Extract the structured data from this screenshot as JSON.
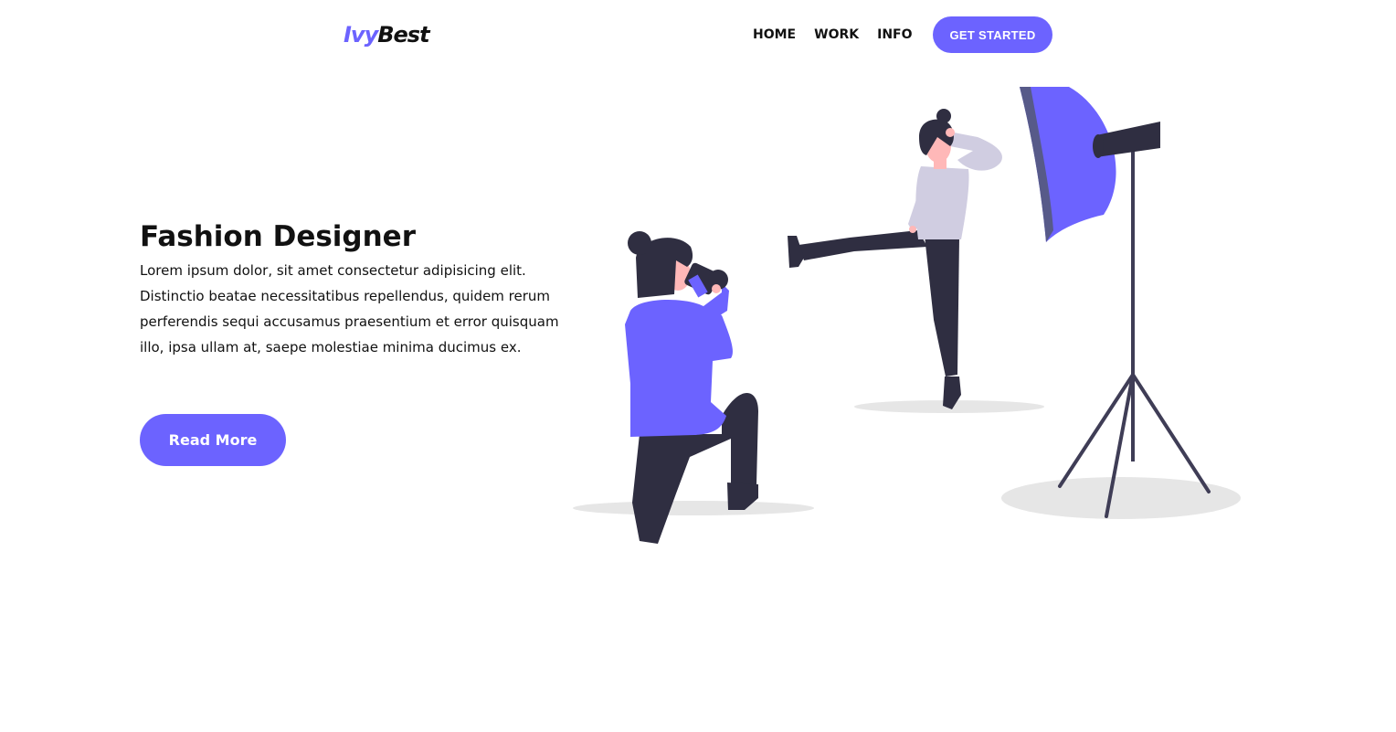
{
  "header": {
    "logo_part1": "Ivy",
    "logo_part2": "Best",
    "nav": [
      "HOME",
      "WORK",
      "INFO"
    ],
    "cta_label": "GET STARTED"
  },
  "hero": {
    "title": "Fashion Designer",
    "text": "Lorem ipsum dolor, sit amet consectetur adipisicing elit. Distinctio beatae necessitatibus repellendus, quidem rerum perferendis sequi accusamus praesentium et error quisquam illo, ipsa ullam at, saepe molestiae minima ducimus ex.",
    "button_label": "Read More"
  },
  "colors": {
    "accent": "#6c63ff",
    "text": "#111111",
    "dark": "#2f2e41",
    "shirt_model": "#d0cde1",
    "skin": "#ffb8b8",
    "shadow": "#e6e6e6",
    "background": "#ffffff"
  }
}
